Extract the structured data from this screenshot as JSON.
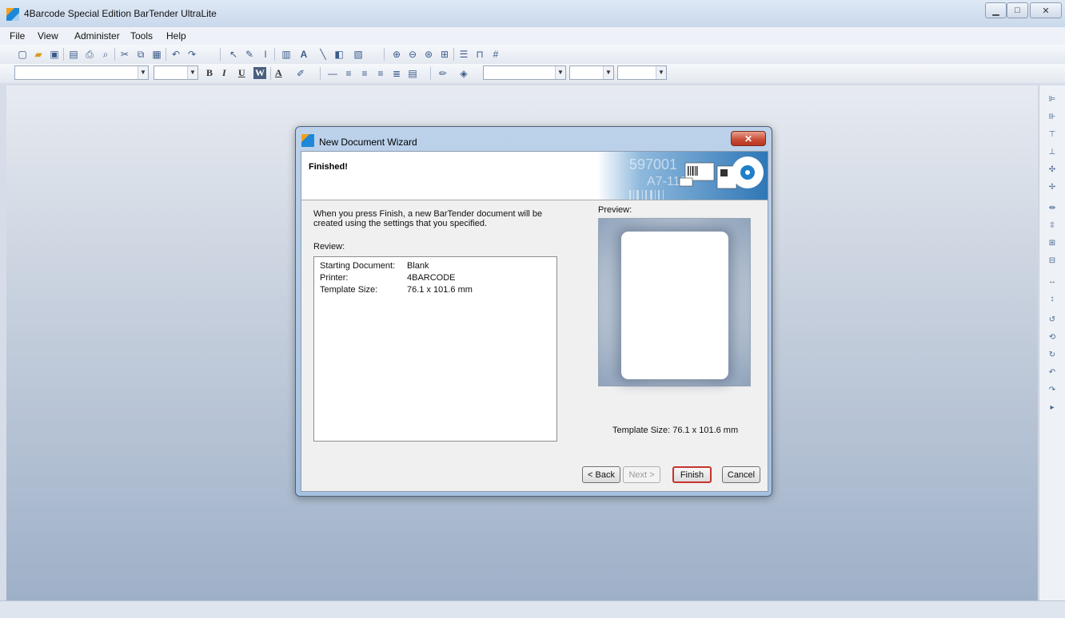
{
  "window": {
    "title": "4Barcode Special Edition BarTender UltraLite"
  },
  "menu": {
    "items": [
      "File",
      "View",
      "Administer",
      "Tools",
      "Help"
    ]
  },
  "toolbar2": {
    "bold": "B",
    "italic": "I",
    "underline": "U",
    "word": "W",
    "font_color": "A"
  },
  "dialog": {
    "title": "New Document Wizard",
    "heading": "Finished!",
    "intro": "When you press Finish, a new BarTender document will be created using the settings that you specified.",
    "review_label": "Review:",
    "review": [
      {
        "key": "Starting Document:",
        "value": "Blank"
      },
      {
        "key": "Printer:",
        "value": "4BARCODE"
      },
      {
        "key": "Template Size:",
        "value": "76.1 x 101.6 mm"
      }
    ],
    "preview_label": "Preview:",
    "template_size_text": "Template Size:  76.1 x 101.6 mm",
    "buttons": {
      "back": "< Back",
      "next": "Next >",
      "finish": "Finish",
      "cancel": "Cancel"
    },
    "header_art_text": {
      "line1": "597001",
      "line2": "A7-118"
    }
  },
  "colors": {
    "finish_highlight": "#c8332d",
    "close_red": "#c94a34",
    "accent_blue": "#2b7bc0"
  }
}
